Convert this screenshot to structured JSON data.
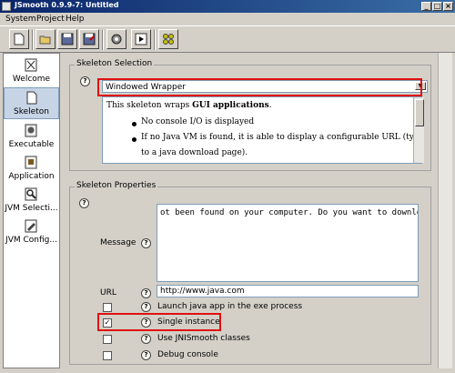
{
  "window": {
    "title": "JSmooth 0.9.9-7: Untitled"
  },
  "menu": [
    "System",
    "Project",
    "Help"
  ],
  "toolbar": {
    "buttons": [
      "new-file-icon",
      "open-folder-icon",
      "save-icon",
      "save-as-icon",
      "settings-gear-icon",
      "run-icon",
      "compile-icon"
    ]
  },
  "sidebar": {
    "items": [
      {
        "label": "Welcome",
        "icon": "welcome-icon"
      },
      {
        "label": "Skeleton",
        "icon": "skeleton-icon",
        "selected": true
      },
      {
        "label": "Executable",
        "icon": "executable-icon"
      },
      {
        "label": "Application",
        "icon": "application-icon"
      },
      {
        "label": "JVM Selecti...",
        "icon": "jvm-selection-icon"
      },
      {
        "label": "JVM Config...",
        "icon": "jvm-config-icon"
      }
    ]
  },
  "skeleton_selection": {
    "title": "Skeleton Selection",
    "selected": "Windowed Wrapper",
    "description": {
      "intro_prefix": "This skeleton wraps ",
      "intro_bold": "GUI applications",
      "intro_suffix": ".",
      "bullets": [
        "No console I/O is displayed",
        "If no Java VM is found, it is able to display a configurable URL (typically",
        "to a java download page)."
      ]
    }
  },
  "skeleton_properties": {
    "title": "Skeleton Properties",
    "message_label": "Message",
    "message_value": "ot been found on your computer. Do you want to download it?",
    "url_label": "URL",
    "url_value": "http://www.java.com",
    "options": [
      {
        "label": "Launch java app in the exe process",
        "checked": false
      },
      {
        "label": "Single instance",
        "checked": true
      },
      {
        "label": "Use JNISmooth classes",
        "checked": false
      },
      {
        "label": "Debug console",
        "checked": false
      }
    ]
  },
  "colors": {
    "highlight": "#e01010",
    "titlebar": "#0a246a",
    "selection": "#c7d4e6"
  }
}
